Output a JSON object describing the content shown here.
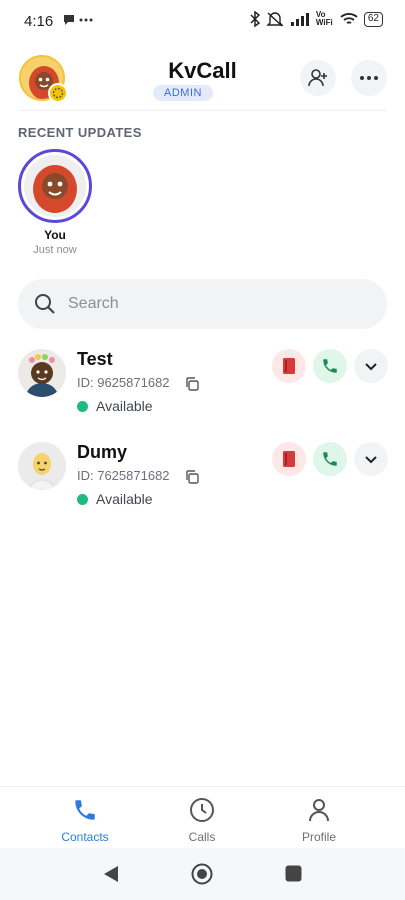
{
  "status_bar": {
    "time": "4:16",
    "left_icons": "⬤ ···",
    "signal_text": "Vo WiFi",
    "battery": "62"
  },
  "header": {
    "title": "KvCall",
    "role_badge": "ADMIN"
  },
  "recent_updates": {
    "section_label": "RECENT UPDATES",
    "items": [
      {
        "name": "You",
        "time": "Just now"
      }
    ]
  },
  "search": {
    "placeholder": "Search"
  },
  "contacts": [
    {
      "name": "Test",
      "id": "ID: 9625871682",
      "status": "Available"
    },
    {
      "name": "Dumy",
      "id": "ID: 7625871682",
      "status": "Available"
    }
  ],
  "bottom_nav": {
    "items": [
      {
        "label": "Contacts",
        "icon": "phone-icon",
        "active": true
      },
      {
        "label": "Calls",
        "icon": "clock-icon",
        "active": false
      },
      {
        "label": "Profile",
        "icon": "person-icon",
        "active": false
      }
    ]
  },
  "colors": {
    "accent": "#2d7be0",
    "story_ring": "#5a49d8",
    "available": "#1dbb7d",
    "call_bg": "#dff6ea",
    "book_bg": "#fde7e7"
  }
}
